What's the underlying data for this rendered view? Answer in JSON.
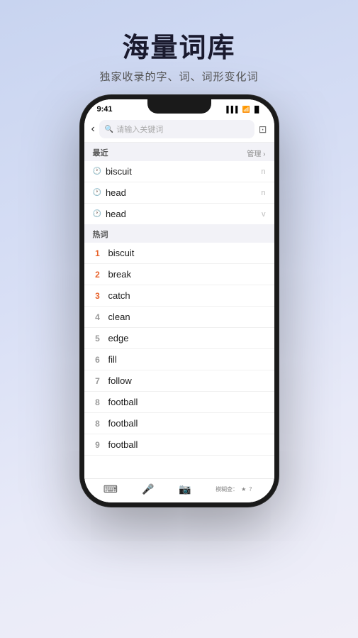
{
  "page": {
    "title": "海量词库",
    "subtitle": "独家收录的字、词、词形变化词",
    "background_colors": [
      "#c8d4f0",
      "#f0eff8"
    ]
  },
  "status_bar": {
    "time": "9:41",
    "signal": "▌▌▌",
    "wifi": "WiFi",
    "battery": "🔋"
  },
  "search_bar": {
    "back_label": "‹",
    "placeholder": "请输入关键词",
    "scan_label": "⊡"
  },
  "recent_section": {
    "title": "最近",
    "action": "管理 ›",
    "items": [
      {
        "word": "biscuit",
        "type": "n"
      },
      {
        "word": "head",
        "type": "n"
      },
      {
        "word": "head",
        "type": "v"
      }
    ]
  },
  "hot_section": {
    "title": "热词",
    "items": [
      {
        "rank": "1",
        "word": "biscuit",
        "class": "rank1"
      },
      {
        "rank": "2",
        "word": "break",
        "class": "rank2"
      },
      {
        "rank": "3",
        "word": "catch",
        "class": "rank3"
      },
      {
        "rank": "4",
        "word": "clean",
        "class": "rank-other"
      },
      {
        "rank": "5",
        "word": "edge",
        "class": "rank-other"
      },
      {
        "rank": "6",
        "word": "fill",
        "class": "rank-other"
      },
      {
        "rank": "7",
        "word": "follow",
        "class": "rank-other"
      },
      {
        "rank": "8",
        "word": "football",
        "class": "rank-other"
      },
      {
        "rank": "8",
        "word": "football",
        "class": "rank-other"
      },
      {
        "rank": "9",
        "word": "football",
        "class": "rank-other"
      }
    ]
  },
  "toolbar": {
    "keyboard_icon": "⌨",
    "mic_icon": "🎤",
    "camera_icon": "📷",
    "fuzzy_label": "模糊查：",
    "star_icon": "★",
    "question_icon": "？"
  }
}
